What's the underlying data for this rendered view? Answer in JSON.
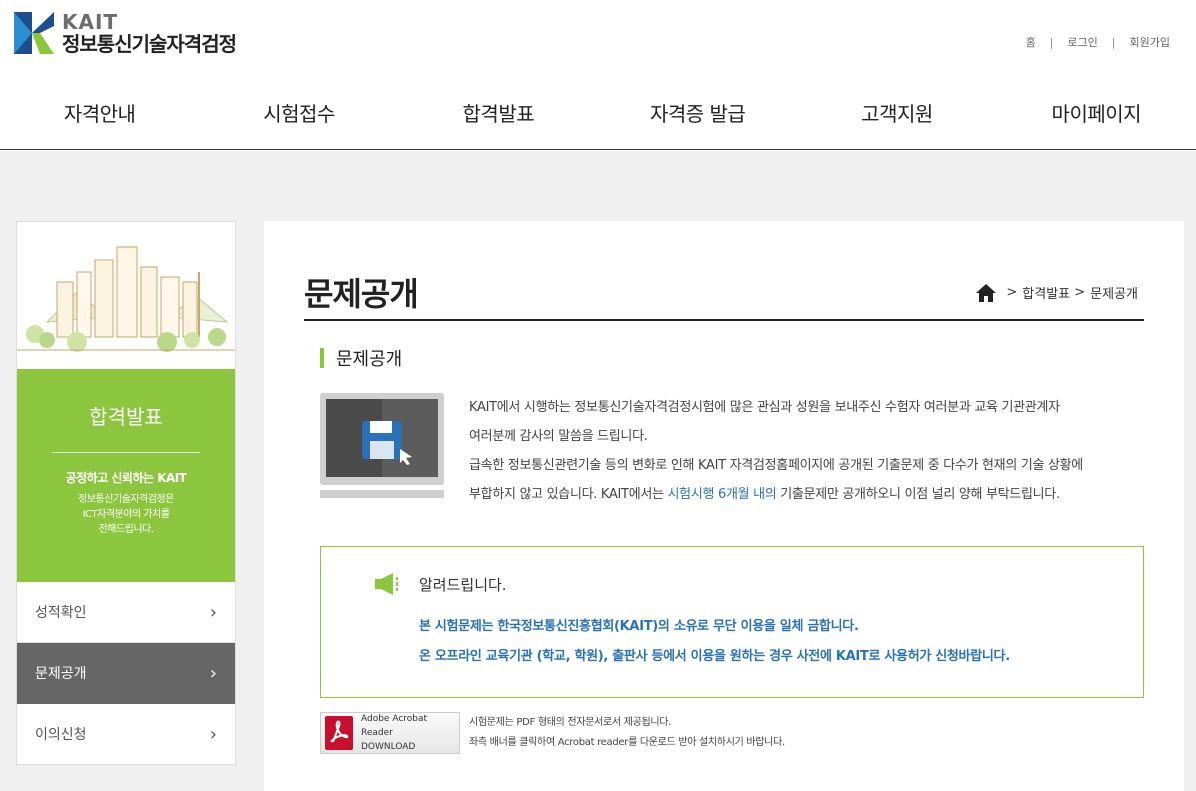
{
  "header": {
    "logo_en": "KAIT",
    "logo_ko": "정보통신기술자격검정",
    "util_nav": [
      "홈",
      "로그인",
      "회원가입"
    ],
    "gnb": [
      "자격안내",
      "시험접수",
      "합격발표",
      "자격증 발급",
      "고객지원",
      "마이페이지"
    ]
  },
  "sidebar": {
    "banner_title": "합격발표",
    "slogan": "공정하고 신뢰하는 KAIT",
    "desc_line1": "정보통신기술자격검정은",
    "desc_line2": "ICT자격분야의 가치를",
    "desc_line3": "전해드립니다.",
    "menu": [
      {
        "label": "성적확인",
        "active": false
      },
      {
        "label": "문제공개",
        "active": true
      },
      {
        "label": "이의신청",
        "active": false
      }
    ]
  },
  "main": {
    "page_title": "문제공개",
    "breadcrumb": [
      "합격발표",
      "문제공개"
    ],
    "section_title": "문제공개",
    "intro_line1": "KAIT에서 시행하는 정보통신기술자격검정시험에 많은 관심과 성원을 보내주신 수험자 여러분과 교육 기관관계자",
    "intro_line2": "여러분께 감사의 말씀을 드립니다.",
    "intro_line3": "급속한 정보통신관련기술 등의 변화로 인해 KAIT 자격검정홈페이지에 공개된 기출문제 중 다수가 현재의 기술 상황에",
    "intro_line4_a": "부합하지 않고 있습니다. KAIT에서는 ",
    "intro_line4_hl": "시험시행 6개월 내의",
    "intro_line4_b": " 기출문제만 공개하오니 이점 널리 양해 부탁드립니다.",
    "notice_title": "알려드립니다.",
    "notice_line1": "본 시험문제는 한국정보통신진흥협회(KAIT)의 소유로 무단 이용을 일체 금합니다.",
    "notice_line2": "온 오프라인 교육기관 (학교, 학원), 출판사 등에서 이용을 원하는 경우 사전에 KAIT로 사용허가 신청바랍니다.",
    "acrobat_line1": "Adobe Acrobat Reader",
    "acrobat_line2": "DOWNLOAD",
    "acrobat_note1": "시험문제는 PDF 형태의 전자문서로서 제공됩니다.",
    "acrobat_note2": "좌측 배너를 클릭하여 Acrobat reader를 다운로드 받아 설치하시기 바랍니다."
  },
  "colors": {
    "accent_green": "#8cc63f",
    "link_blue": "#2a72b5",
    "logo_blue": "#1f4e8c",
    "active_menu": "#666666"
  }
}
